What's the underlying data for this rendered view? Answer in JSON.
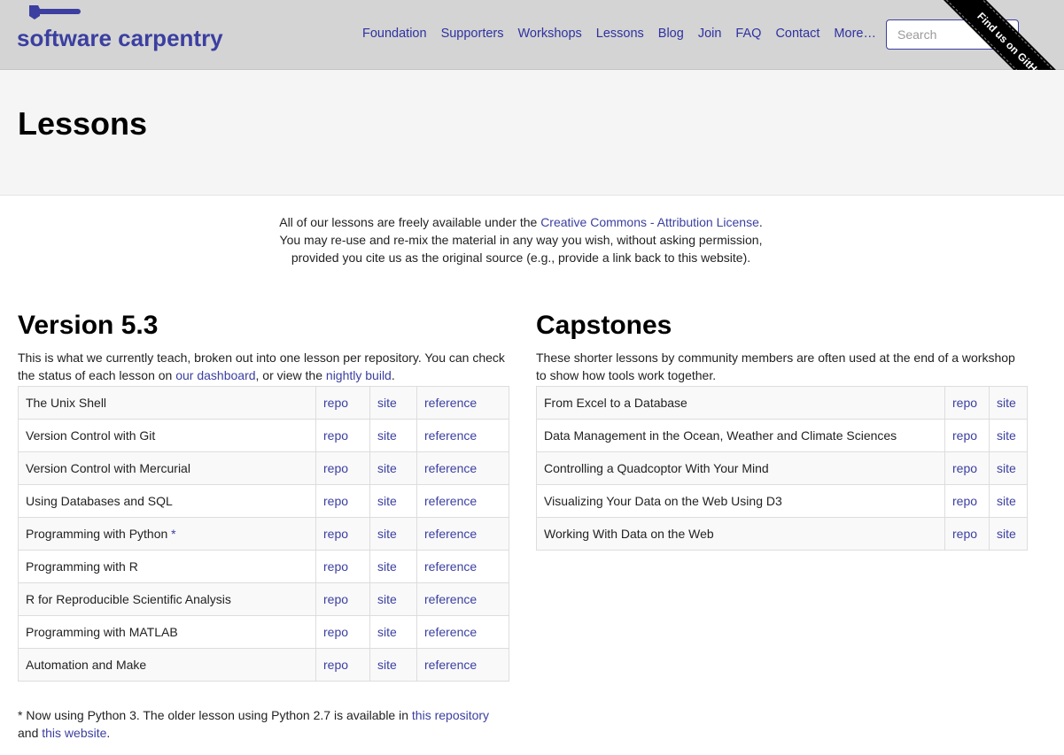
{
  "header": {
    "logo_text": "software carpentry",
    "nav": [
      "Foundation",
      "Supporters",
      "Workshops",
      "Lessons",
      "Blog",
      "Join",
      "FAQ",
      "Contact",
      "More…"
    ],
    "search_placeholder": "Search",
    "ribbon": "Find us on GitHub"
  },
  "hero": {
    "title": "Lessons"
  },
  "intro": {
    "line1_prefix": "All of our lessons are freely available under the ",
    "line1_link": "Creative Commons - Attribution License",
    "line1_suffix": ".",
    "line2": "You may re-use and re-mix the material in any way you wish, without asking permission,",
    "line3": "provided you cite us as the original source (e.g., provide a link back to this website)."
  },
  "version": {
    "title": "Version 5.3",
    "desc_prefix": "This is what we currently teach, broken out into one lesson per repository. You can check the status of each lesson on ",
    "dashboard_link": "our dashboard",
    "desc_middle": ", or view the ",
    "nightly_link": "nightly build",
    "desc_suffix": ".",
    "lessons": [
      {
        "name": "The Unix Shell",
        "star": "",
        "repo": "repo",
        "site": "site",
        "ref": "reference"
      },
      {
        "name": "Version Control with Git",
        "star": "",
        "repo": "repo",
        "site": "site",
        "ref": "reference"
      },
      {
        "name": "Version Control with Mercurial",
        "star": "",
        "repo": "repo",
        "site": "site",
        "ref": "reference"
      },
      {
        "name": "Using Databases and SQL",
        "star": "",
        "repo": "repo",
        "site": "site",
        "ref": "reference"
      },
      {
        "name": "Programming with Python",
        "star": " *",
        "repo": "repo",
        "site": "site",
        "ref": "reference"
      },
      {
        "name": "Programming with R",
        "star": "",
        "repo": "repo",
        "site": "site",
        "ref": "reference"
      },
      {
        "name": "R for Reproducible Scientific Analysis",
        "star": "",
        "repo": "repo",
        "site": "site",
        "ref": "reference"
      },
      {
        "name": "Programming with MATLAB",
        "star": "",
        "repo": "repo",
        "site": "site",
        "ref": "reference"
      },
      {
        "name": "Automation and Make",
        "star": "",
        "repo": "repo",
        "site": "site",
        "ref": "reference"
      }
    ]
  },
  "capstones": {
    "title": "Capstones",
    "desc": "These shorter lessons by community members are often used at the end of a workshop to show how tools work together.",
    "lessons": [
      {
        "name": "From Excel to a Database",
        "repo": "repo",
        "site": "site"
      },
      {
        "name": "Data Management in the Ocean, Weather and Climate Sciences",
        "repo": "repo",
        "site": "site"
      },
      {
        "name": "Controlling a Quadcoptor With Your Mind",
        "repo": "repo",
        "site": "site"
      },
      {
        "name": "Visualizing Your Data on the Web Using D3",
        "repo": "repo",
        "site": "site"
      },
      {
        "name": "Working With Data on the Web",
        "repo": "repo",
        "site": "site"
      }
    ]
  },
  "footnote": {
    "prefix": "* Now using Python 3. The older lesson using Python 2.7 is available in ",
    "link1": "this repository",
    "middle": " and ",
    "link2": "this website",
    "suffix": "."
  },
  "colors": {
    "link": "#3b3fa0",
    "navbar": "#d4d4d4",
    "hero": "#f5f5f5"
  },
  "icons": [
    "hammer-icon"
  ]
}
